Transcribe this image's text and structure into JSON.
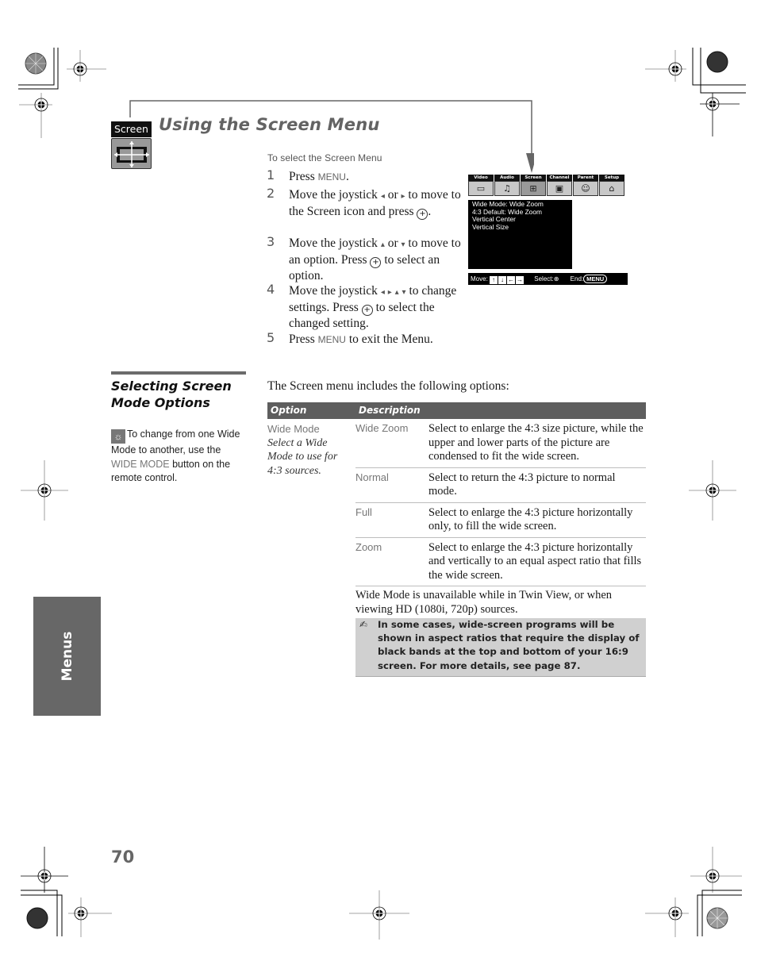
{
  "header": {
    "badge_label": "Screen",
    "title": "Using the Screen Menu"
  },
  "steps": {
    "heading": "To select the Screen Menu",
    "items": [
      {
        "num": "1",
        "parts": [
          "Press ",
          "MENU",
          "."
        ]
      },
      {
        "num": "2",
        "text_a": "Move the joystick",
        "text_b": "or",
        "text_c": "to move to the Screen icon and press",
        "text_d": "."
      },
      {
        "num": "3",
        "text_a": "Move the joystick",
        "text_b": "or",
        "text_c": "to move to an option. Press",
        "text_d": "to select an option."
      },
      {
        "num": "4",
        "text_a": "Move the joystick",
        "text_c": "to change settings. Press",
        "text_d": "to select the changed setting."
      },
      {
        "num": "5",
        "parts": [
          "Press ",
          "MENU",
          " to exit the Menu."
        ]
      }
    ],
    "icons": {
      "left": "◆",
      "right": "◆",
      "up": "▲",
      "down": "▼",
      "select": "+"
    }
  },
  "tv_menu": {
    "tabs": [
      {
        "label": "Video",
        "icon": "▭"
      },
      {
        "label": "Audio",
        "icon": "♫"
      },
      {
        "label": "Screen",
        "icon": "⊞",
        "active": true
      },
      {
        "label": "Channel",
        "icon": "▣"
      },
      {
        "label": "Parent",
        "icon": "☺"
      },
      {
        "label": "Setup",
        "icon": "⌂"
      }
    ],
    "lines": [
      "Wide Mode: Wide Zoom",
      "4:3 Default: Wide Zoom",
      "Vertical Center",
      "Vertical Size"
    ],
    "footer": {
      "move_label": "Move:",
      "select_label": "Select:",
      "end_label": "End:",
      "end_button": "MENU",
      "keys": [
        "↑",
        "↓",
        "←",
        "→"
      ]
    }
  },
  "section": {
    "title": "Selecting Screen Mode Options",
    "tip": {
      "pre": "To change from one Wide Mode to another, use the ",
      "highlight": "WIDE MODE",
      "post": " button on the remote control."
    },
    "intro": "The Screen menu includes the following options:"
  },
  "table": {
    "headers": [
      "Option",
      "Description"
    ],
    "option": {
      "name": "Wide Mode",
      "description": "Select a Wide Mode to use for 4:3 sources."
    },
    "rows": [
      {
        "mode": "Wide Zoom",
        "description": "Select to enlarge the 4:3 size picture, while the upper and lower parts of the picture are condensed to fit the wide screen."
      },
      {
        "mode": "Normal",
        "description": "Select to return the 4:3 picture to normal mode."
      },
      {
        "mode": "Full",
        "description": "Select to enlarge the 4:3 picture horizontally only, to fill the wide screen."
      },
      {
        "mode": "Zoom",
        "description": "Select to enlarge the 4:3 picture horizontally and vertically to an equal aspect ratio that fills the wide screen."
      }
    ],
    "unavailable_note": "Wide Mode is unavailable while in Twin View, or when viewing HD (1080i, 720p) sources.",
    "note": "In some cases, wide-screen programs will be shown in aspect ratios that require the display of black bands at the top and bottom of your 16:9 screen. For more details, see page 87."
  },
  "side_tab": "Menus",
  "page_number": "70"
}
